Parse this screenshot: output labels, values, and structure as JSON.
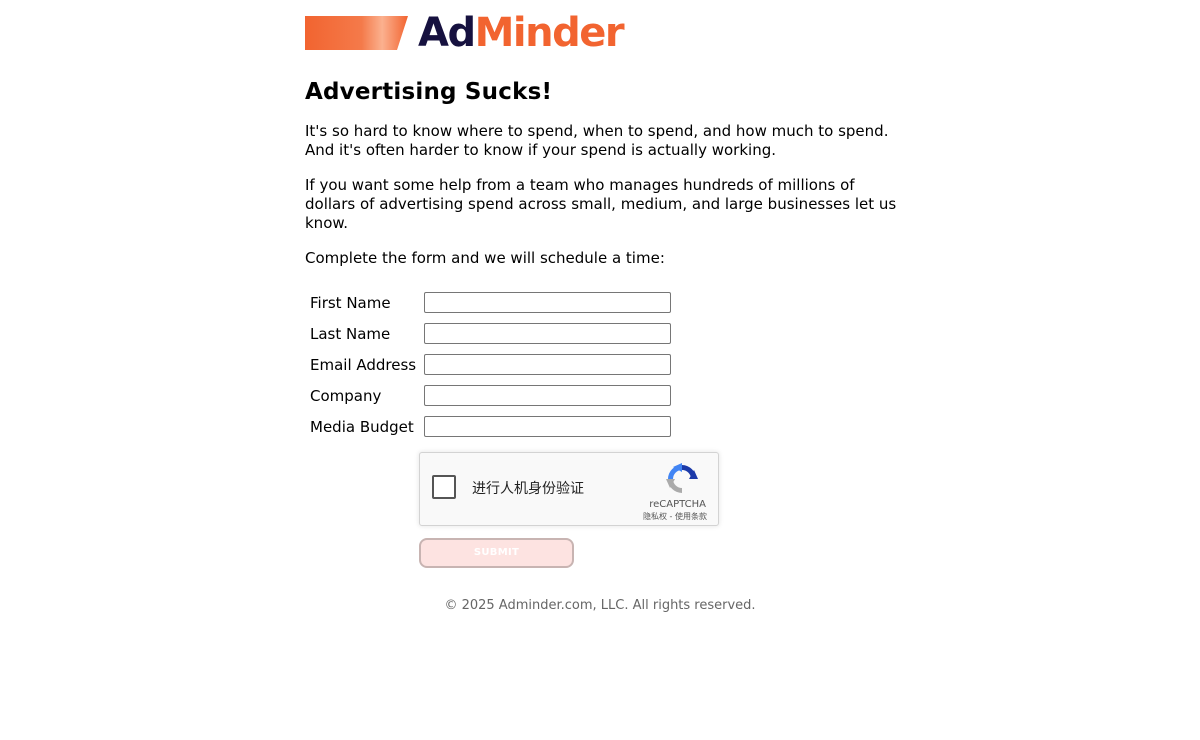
{
  "logo": {
    "part1": "Ad",
    "part2": "Minder",
    "colors": {
      "dark": "#16113f",
      "accent": "#f26430"
    }
  },
  "headline": "Advertising Sucks!",
  "paragraphs": [
    "It's so hard to know where to spend, when to spend, and how much to spend. And it's often harder to know if your spend is actually working.",
    "If you want some help from a team who manages hundreds of millions of dollars of advertising spend across small, medium, and large businesses let us know.",
    "Complete the form and we will schedule a time:"
  ],
  "form": {
    "fields": [
      {
        "label": "First Name",
        "value": "",
        "placeholder": ""
      },
      {
        "label": "Last Name",
        "value": "",
        "placeholder": ""
      },
      {
        "label": "Email Address",
        "value": "",
        "placeholder": ""
      },
      {
        "label": "Company",
        "value": "",
        "placeholder": ""
      },
      {
        "label": "Media Budget",
        "value": "",
        "placeholder": ""
      }
    ],
    "recaptcha": {
      "label": "进行人机身份验证",
      "brand": "reCAPTCHA",
      "privacy": "隐私权",
      "separator": " - ",
      "terms": "使用条款",
      "icon": "recaptcha-logo-icon"
    },
    "submit_label": "SUBMIT"
  },
  "footer": "© 2025 Adminder.com, LLC. All rights reserved."
}
